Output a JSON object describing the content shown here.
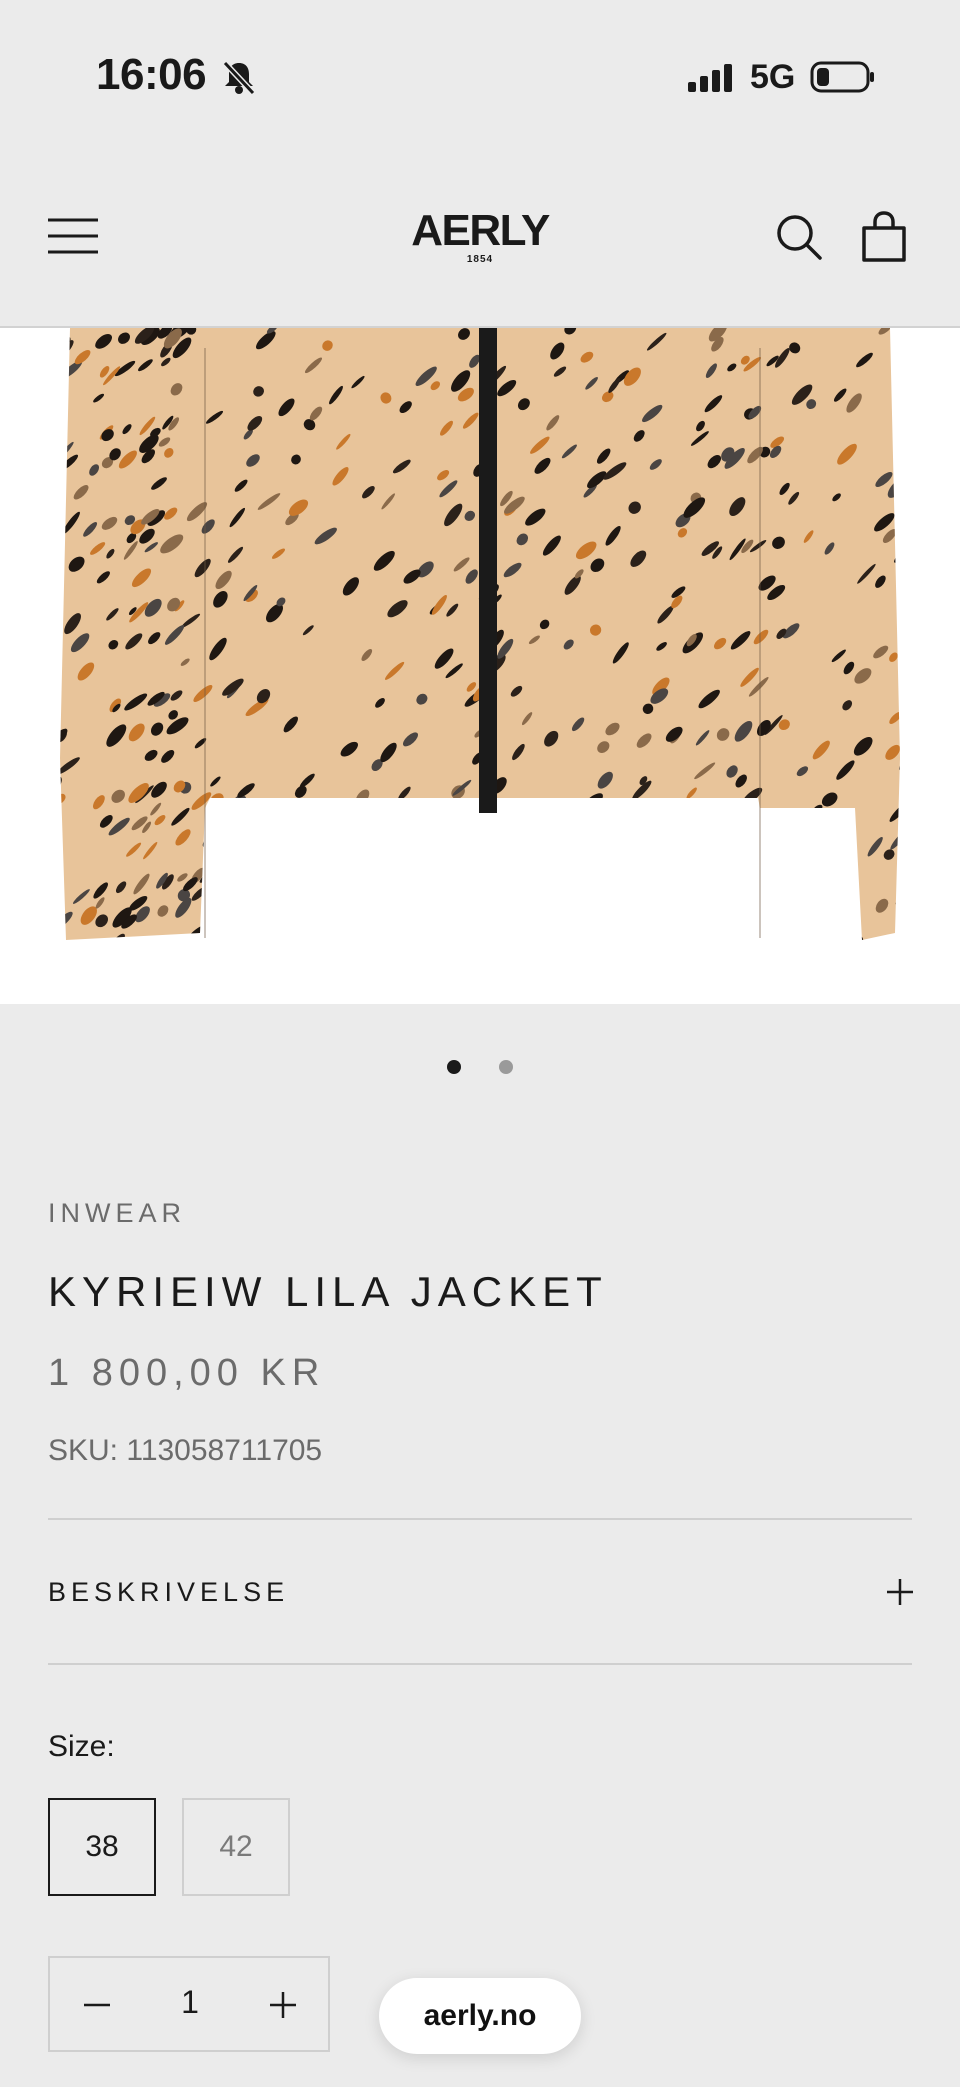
{
  "status_bar": {
    "time": "16:06",
    "network": "5G"
  },
  "header": {
    "logo_text": "AERLY",
    "logo_year": "1854"
  },
  "gallery": {
    "slide_count": 2,
    "active_slide": 1
  },
  "product": {
    "brand": "INWEAR",
    "title": "KYRIEIW LILA JACKET",
    "price": "1 800,00 KR",
    "sku": "SKU: 113058711705"
  },
  "accordion": {
    "description_label": "BESKRIVELSE"
  },
  "size": {
    "label": "Size:",
    "options": [
      "38",
      "42"
    ],
    "selected": "38"
  },
  "quantity": {
    "value": "1"
  },
  "browser": {
    "url": "aerly.no"
  }
}
